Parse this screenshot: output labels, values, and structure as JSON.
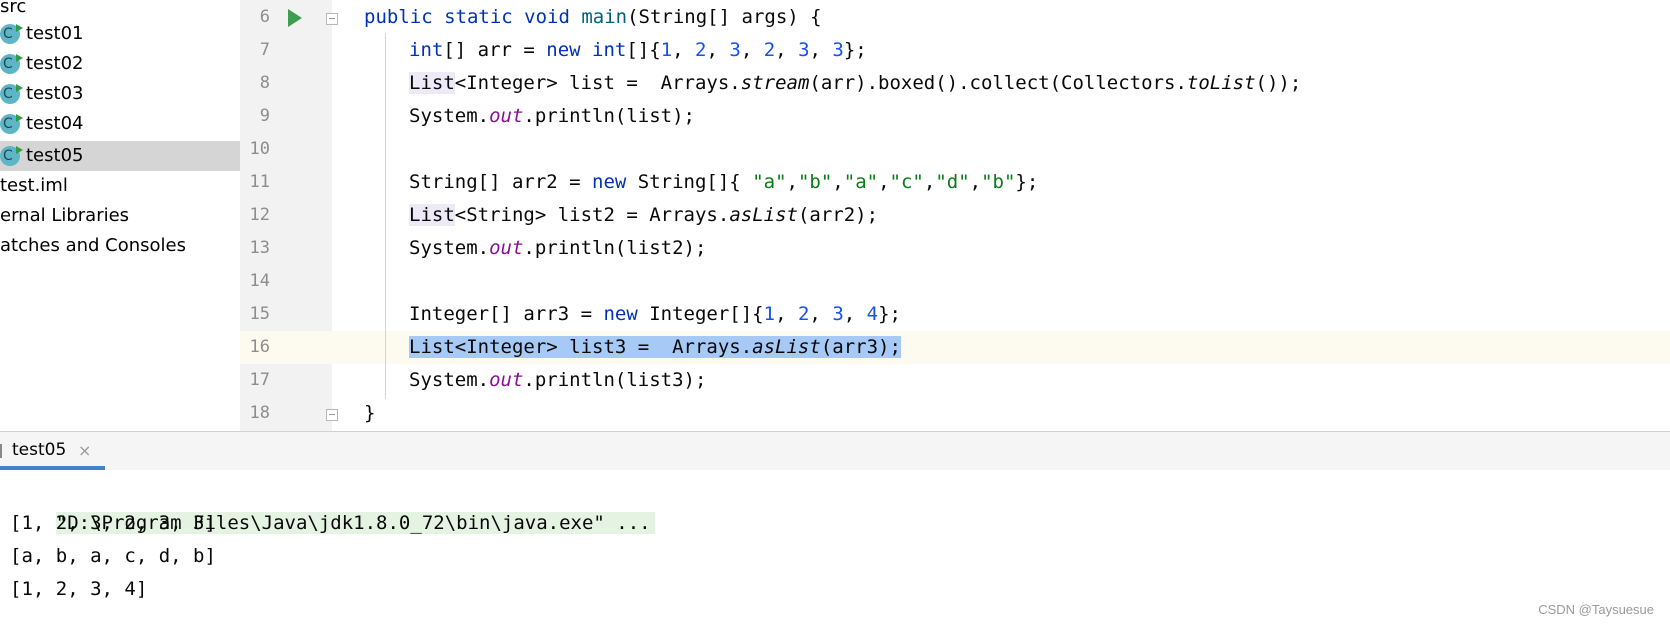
{
  "project_tree": {
    "items": [
      {
        "label": "src",
        "kind": "folder",
        "selected": false
      },
      {
        "label": "test01",
        "kind": "class",
        "selected": false
      },
      {
        "label": "test02",
        "kind": "class",
        "selected": false
      },
      {
        "label": "test03",
        "kind": "class",
        "selected": false
      },
      {
        "label": "test04",
        "kind": "class",
        "selected": false
      },
      {
        "label": "test05",
        "kind": "class",
        "selected": true
      },
      {
        "label": "test.iml",
        "kind": "file",
        "selected": false
      },
      {
        "label": "ernal Libraries",
        "kind": "node",
        "selected": false
      },
      {
        "label": "atches and Consoles",
        "kind": "node",
        "selected": false
      }
    ],
    "class_icon_letter": "C",
    "class_icon_color": "#5db5c6"
  },
  "editor": {
    "caret_line": "16",
    "line_numbers": [
      "6",
      "7",
      "8",
      "9",
      "10",
      "11",
      "12",
      "13",
      "14",
      "15",
      "16",
      "17",
      "18"
    ],
    "lines": [
      [
        [
          "kw",
          "public static void "
        ],
        [
          "fn",
          "main"
        ],
        [
          "",
          "(String[] args) {"
        ]
      ],
      [
        [
          "kw",
          "int"
        ],
        [
          "",
          "[] arr = "
        ],
        [
          "kw",
          "new int"
        ],
        [
          "",
          "[]{"
        ],
        [
          "num",
          "1"
        ],
        [
          "",
          ", "
        ],
        [
          "num",
          "2"
        ],
        [
          "",
          ", "
        ],
        [
          "num",
          "3"
        ],
        [
          "",
          ", "
        ],
        [
          "num",
          "2"
        ],
        [
          "",
          ", "
        ],
        [
          "num",
          "3"
        ],
        [
          "",
          ", "
        ],
        [
          "num",
          "3"
        ],
        [
          "",
          "};"
        ]
      ],
      [
        [
          "warn",
          "List"
        ],
        [
          "",
          "<Integer> list =  Arrays."
        ],
        [
          "it",
          "stream"
        ],
        [
          "",
          "(arr).boxed().collect(Collectors."
        ],
        [
          "it",
          "toList"
        ],
        [
          "",
          "());"
        ]
      ],
      [
        [
          "",
          "System."
        ],
        [
          "static",
          "out"
        ],
        [
          "",
          ".println(list);"
        ]
      ],
      [],
      [
        [
          "",
          "String[] arr2 = "
        ],
        [
          "kw",
          "new "
        ],
        [
          "",
          "String[]{ "
        ],
        [
          "str",
          "\"a\""
        ],
        [
          "",
          ","
        ],
        [
          "str",
          "\"b\""
        ],
        [
          "",
          ","
        ],
        [
          "str",
          "\"a\""
        ],
        [
          "",
          ","
        ],
        [
          "str",
          "\"c\""
        ],
        [
          "",
          ","
        ],
        [
          "str",
          "\"d\""
        ],
        [
          "",
          ","
        ],
        [
          "str",
          "\"b\""
        ],
        [
          "",
          "};"
        ]
      ],
      [
        [
          "warn",
          "List"
        ],
        [
          "",
          "<String> list2 = Arrays."
        ],
        [
          "it",
          "asList"
        ],
        [
          "",
          "(arr2);"
        ]
      ],
      [
        [
          "",
          "System."
        ],
        [
          "static",
          "out"
        ],
        [
          "",
          ".println(list2);"
        ]
      ],
      [],
      [
        [
          "",
          "Integer[] arr3 = "
        ],
        [
          "kw",
          "new "
        ],
        [
          "",
          "Integer[]{"
        ],
        [
          "num",
          "1"
        ],
        [
          "",
          ", "
        ],
        [
          "num",
          "2"
        ],
        [
          "",
          ", "
        ],
        [
          "num",
          "3"
        ],
        [
          "",
          ", "
        ],
        [
          "num",
          "4"
        ],
        [
          "",
          "};"
        ]
      ],
      [
        [
          "sel",
          "List<Integer> list3 =  Arrays."
        ],
        [
          "selit",
          "asList"
        ],
        [
          "sel",
          "(arr3);"
        ]
      ],
      [
        [
          "",
          "System."
        ],
        [
          "static",
          "out"
        ],
        [
          "",
          ".println(list3);"
        ]
      ],
      [
        [
          "",
          "}"
        ]
      ]
    ],
    "colors": {
      "keyword": "#0033b3",
      "number": "#1750eb",
      "string": "#067d17",
      "static_field": "#871094",
      "selection": "#a6c9f5",
      "caret_line": "#fdfbef"
    }
  },
  "run_panel": {
    "tab_label": "test05",
    "tab_close_glyph": "×",
    "console_lines": [
      "\"D:\\Program Files\\Java\\jdk1.8.0_72\\bin\\java.exe\" ...",
      "[1, 2, 3, 2, 3, 3]",
      "[a, b, a, c, d, b]",
      "[1, 2, 3, 4]"
    ]
  },
  "watermark": "CSDN @Taysuesue"
}
